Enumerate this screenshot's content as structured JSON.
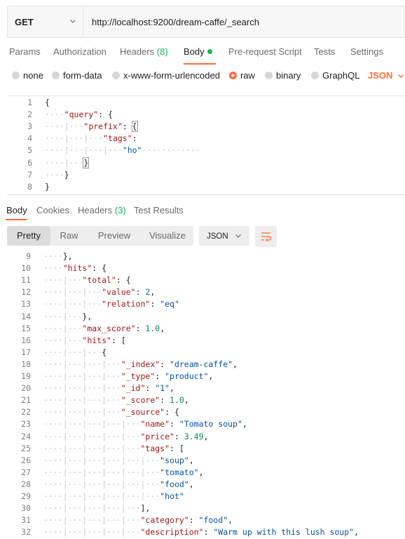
{
  "request": {
    "method": "GET",
    "url": "http://localhost:9200/dream-caffe/_search"
  },
  "request_tabs": [
    {
      "label": "Params"
    },
    {
      "label": "Authorization"
    },
    {
      "label": "Headers",
      "count": "(8)"
    },
    {
      "label": "Body",
      "active": true,
      "has_dot": true
    },
    {
      "label": "Pre-request Script"
    },
    {
      "label": "Tests"
    },
    {
      "label": "Settings"
    }
  ],
  "body_types": [
    {
      "label": "none"
    },
    {
      "label": "form-data"
    },
    {
      "label": "x-www-form-urlencoded"
    },
    {
      "label": "raw",
      "checked": true
    },
    {
      "label": "binary"
    },
    {
      "label": "GraphQL"
    }
  ],
  "body_format": "JSON",
  "request_body": [
    {
      "n": "1",
      "dots": "",
      "tokens": [
        {
          "t": "{",
          "c": "punc"
        }
      ]
    },
    {
      "n": "2",
      "dots": "····",
      "tokens": [
        {
          "t": "\"query\"",
          "c": "key"
        },
        {
          "t": ": {",
          "c": "punc"
        }
      ]
    },
    {
      "n": "3",
      "dots": "····|···",
      "tokens": [
        {
          "t": "\"prefix\"",
          "c": "key"
        },
        {
          "t": ": ",
          "c": "punc"
        },
        {
          "t": "{",
          "c": "punc",
          "box": true
        }
      ]
    },
    {
      "n": "4",
      "dots": "····|···|···",
      "tokens": [
        {
          "t": "\"tags\"",
          "c": "key"
        },
        {
          "t": ":",
          "c": "punc"
        }
      ]
    },
    {
      "n": "5",
      "dots": "····|···|···|···",
      "tokens": [
        {
          "t": "\"ho\"",
          "c": "str"
        },
        {
          "t": "············",
          "c": "ws"
        }
      ]
    },
    {
      "n": "6",
      "dots": "····|···",
      "tokens": [
        {
          "t": "}",
          "c": "punc",
          "box": true
        }
      ]
    },
    {
      "n": "7",
      "dots": "····",
      "tokens": [
        {
          "t": "}",
          "c": "punc"
        }
      ]
    },
    {
      "n": "8",
      "dots": "",
      "tokens": [
        {
          "t": "}",
          "c": "punc"
        }
      ]
    }
  ],
  "response_tabs": [
    {
      "label": "Body",
      "active": true
    },
    {
      "label": "Cookies"
    },
    {
      "label": "Headers",
      "count": "(3)"
    },
    {
      "label": "Test Results"
    }
  ],
  "view_modes": [
    {
      "label": "Pretty",
      "active": true
    },
    {
      "label": "Raw"
    },
    {
      "label": "Preview"
    },
    {
      "label": "Visualize"
    }
  ],
  "response_format": "JSON",
  "icons": {
    "method_caret": "chevron-down-icon",
    "format_caret": "chevron-down-icon",
    "wrap": "wrap-lines-icon"
  },
  "colors": {
    "accent": "#ff6c37",
    "success": "#0cbb52",
    "json_key": "#a31515",
    "json_string": "#0451a5",
    "json_number": "#098658"
  },
  "response_body": [
    {
      "n": "9",
      "dots": "····",
      "tokens": [
        {
          "t": "},",
          "c": "punc"
        }
      ]
    },
    {
      "n": "10",
      "dots": "····",
      "tokens": [
        {
          "t": "\"hits\"",
          "c": "key"
        },
        {
          "t": ": {",
          "c": "punc"
        }
      ]
    },
    {
      "n": "11",
      "dots": "····|···",
      "tokens": [
        {
          "t": "\"total\"",
          "c": "key"
        },
        {
          "t": ": {",
          "c": "punc"
        }
      ]
    },
    {
      "n": "12",
      "dots": "····|···|···",
      "tokens": [
        {
          "t": "\"value\"",
          "c": "key"
        },
        {
          "t": ": ",
          "c": "punc"
        },
        {
          "t": "2",
          "c": "num"
        },
        {
          "t": ",",
          "c": "punc"
        }
      ]
    },
    {
      "n": "13",
      "dots": "····|···|···",
      "tokens": [
        {
          "t": "\"relation\"",
          "c": "key"
        },
        {
          "t": ": ",
          "c": "punc"
        },
        {
          "t": "\"eq\"",
          "c": "str"
        }
      ]
    },
    {
      "n": "14",
      "dots": "····|···",
      "tokens": [
        {
          "t": "},",
          "c": "punc"
        }
      ]
    },
    {
      "n": "15",
      "dots": "····|···",
      "tokens": [
        {
          "t": "\"max_score\"",
          "c": "key"
        },
        {
          "t": ": ",
          "c": "punc"
        },
        {
          "t": "1.0",
          "c": "num"
        },
        {
          "t": ",",
          "c": "punc"
        }
      ]
    },
    {
      "n": "16",
      "dots": "····|···",
      "tokens": [
        {
          "t": "\"hits\"",
          "c": "key"
        },
        {
          "t": ": [",
          "c": "punc"
        }
      ]
    },
    {
      "n": "17",
      "dots": "····|···|···",
      "tokens": [
        {
          "t": "{",
          "c": "punc"
        }
      ]
    },
    {
      "n": "18",
      "dots": "····|···|···|···",
      "tokens": [
        {
          "t": "\"_index\"",
          "c": "key"
        },
        {
          "t": ": ",
          "c": "punc"
        },
        {
          "t": "\"dream-caffe\"",
          "c": "str"
        },
        {
          "t": ",",
          "c": "punc"
        }
      ]
    },
    {
      "n": "19",
      "dots": "····|···|···|···",
      "tokens": [
        {
          "t": "\"_type\"",
          "c": "key"
        },
        {
          "t": ": ",
          "c": "punc"
        },
        {
          "t": "\"product\"",
          "c": "str"
        },
        {
          "t": ",",
          "c": "punc"
        }
      ]
    },
    {
      "n": "20",
      "dots": "····|···|···|···",
      "tokens": [
        {
          "t": "\"_id\"",
          "c": "key"
        },
        {
          "t": ": ",
          "c": "punc"
        },
        {
          "t": "\"1\"",
          "c": "str"
        },
        {
          "t": ",",
          "c": "punc"
        }
      ]
    },
    {
      "n": "21",
      "dots": "····|···|···|···",
      "tokens": [
        {
          "t": "\"_score\"",
          "c": "key"
        },
        {
          "t": ": ",
          "c": "punc"
        },
        {
          "t": "1.0",
          "c": "num"
        },
        {
          "t": ",",
          "c": "punc"
        }
      ]
    },
    {
      "n": "22",
      "dots": "····|···|···|···",
      "tokens": [
        {
          "t": "\"_source\"",
          "c": "key"
        },
        {
          "t": ": {",
          "c": "punc"
        }
      ]
    },
    {
      "n": "23",
      "dots": "····|···|···|···|···",
      "tokens": [
        {
          "t": "\"name\"",
          "c": "key"
        },
        {
          "t": ": ",
          "c": "punc"
        },
        {
          "t": "\"Tomato soup\"",
          "c": "str"
        },
        {
          "t": ",",
          "c": "punc"
        }
      ]
    },
    {
      "n": "24",
      "dots": "····|···|···|···|···",
      "tokens": [
        {
          "t": "\"price\"",
          "c": "key"
        },
        {
          "t": ": ",
          "c": "punc"
        },
        {
          "t": "3.49",
          "c": "num"
        },
        {
          "t": ",",
          "c": "punc"
        }
      ]
    },
    {
      "n": "25",
      "dots": "····|···|···|···|···",
      "tokens": [
        {
          "t": "\"tags\"",
          "c": "key"
        },
        {
          "t": ": [",
          "c": "punc"
        }
      ]
    },
    {
      "n": "26",
      "dots": "····|···|···|···|···|···",
      "tokens": [
        {
          "t": "\"soup\"",
          "c": "str"
        },
        {
          "t": ",",
          "c": "punc"
        }
      ]
    },
    {
      "n": "27",
      "dots": "····|···|···|···|···|···",
      "tokens": [
        {
          "t": "\"tomato\"",
          "c": "str"
        },
        {
          "t": ",",
          "c": "punc"
        }
      ]
    },
    {
      "n": "28",
      "dots": "····|···|···|···|···|···",
      "tokens": [
        {
          "t": "\"food\"",
          "c": "str"
        },
        {
          "t": ",",
          "c": "punc"
        }
      ]
    },
    {
      "n": "29",
      "dots": "····|···|···|···|···|···",
      "tokens": [
        {
          "t": "\"hot\"",
          "c": "str"
        }
      ]
    },
    {
      "n": "30",
      "dots": "····|···|···|···|···",
      "tokens": [
        {
          "t": "],",
          "c": "punc"
        }
      ]
    },
    {
      "n": "31",
      "dots": "····|···|···|···|···",
      "tokens": [
        {
          "t": "\"category\"",
          "c": "key"
        },
        {
          "t": ": ",
          "c": "punc"
        },
        {
          "t": "\"food\"",
          "c": "str"
        },
        {
          "t": ",",
          "c": "punc"
        }
      ]
    },
    {
      "n": "32",
      "dots": "····|···|···|···|···",
      "tokens": [
        {
          "t": "\"description\"",
          "c": "key"
        },
        {
          "t": ": ",
          "c": "punc"
        },
        {
          "t": "\"Warm up with this lush soup\"",
          "c": "str"
        },
        {
          "t": ",",
          "c": "punc"
        }
      ]
    }
  ]
}
